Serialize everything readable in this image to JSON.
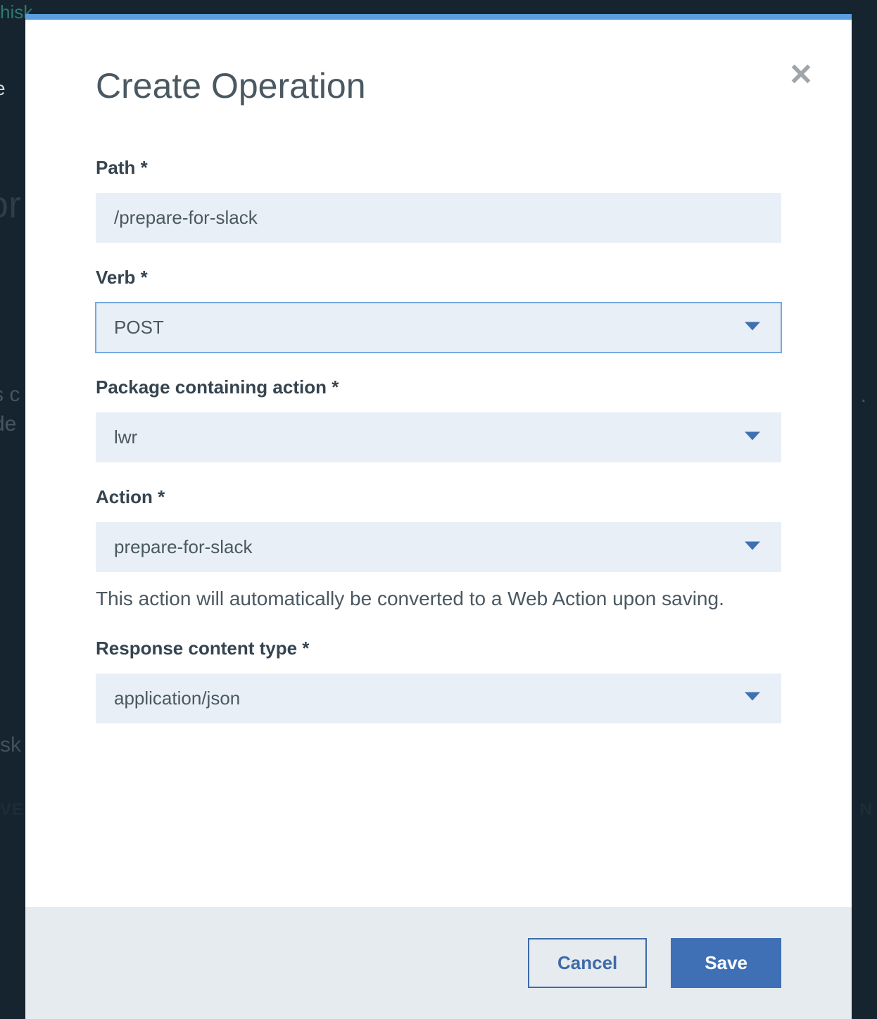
{
  "background": {
    "top_hint": "hisk",
    "left_nav_hint": "e",
    "left_title_hint": "or",
    "mid_line1": "s c",
    "mid_line2": "de",
    "sk_hint": "sk",
    "ve_hint": "VE",
    "n_hint": "N",
    "dot_hint": "."
  },
  "modal": {
    "title": "Create Operation",
    "close_label": "Close",
    "fields": {
      "path": {
        "label": "Path *",
        "value": "/prepare-for-slack"
      },
      "verb": {
        "label": "Verb *",
        "value": "POST"
      },
      "package": {
        "label": "Package containing action *",
        "value": "lwr"
      },
      "action": {
        "label": "Action *",
        "value": "prepare-for-slack",
        "help": "This action will automatically be converted to a Web Action upon saving."
      },
      "response_type": {
        "label": "Response content type *",
        "value": "application/json"
      }
    },
    "buttons": {
      "cancel": "Cancel",
      "save": "Save"
    }
  }
}
